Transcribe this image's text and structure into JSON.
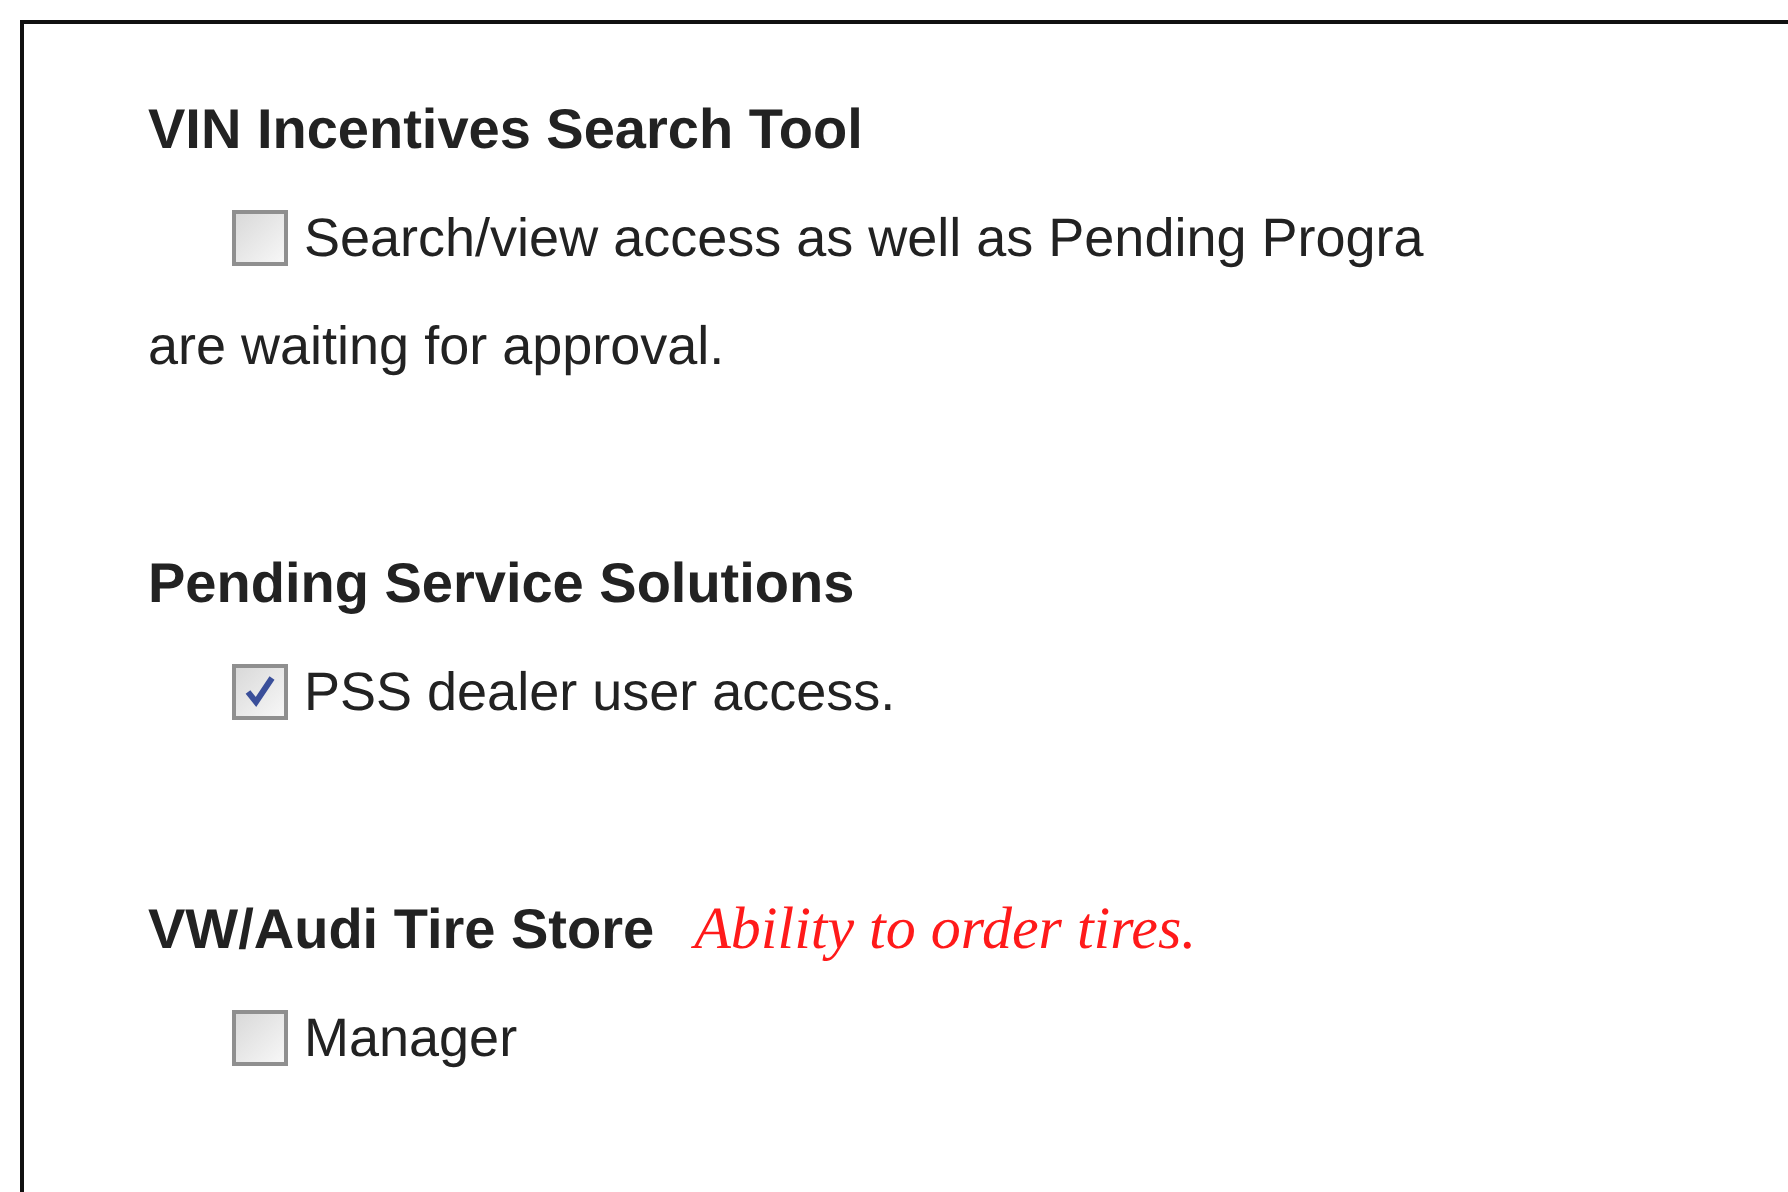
{
  "sections": [
    {
      "title": "VIN Incentives Search Tool",
      "options": [
        {
          "checked": false,
          "lines": [
            "Search/view access as well as Pending Progra",
            "are waiting for approval."
          ]
        }
      ]
    },
    {
      "title": "Pending Service Solutions",
      "options": [
        {
          "checked": true,
          "lines": [
            "PSS dealer user access."
          ]
        }
      ]
    },
    {
      "title": "VW/Audi Tire Store",
      "note": "Ability to order tires.",
      "options": [
        {
          "checked": false,
          "lines": [
            "Manager"
          ]
        }
      ]
    }
  ]
}
